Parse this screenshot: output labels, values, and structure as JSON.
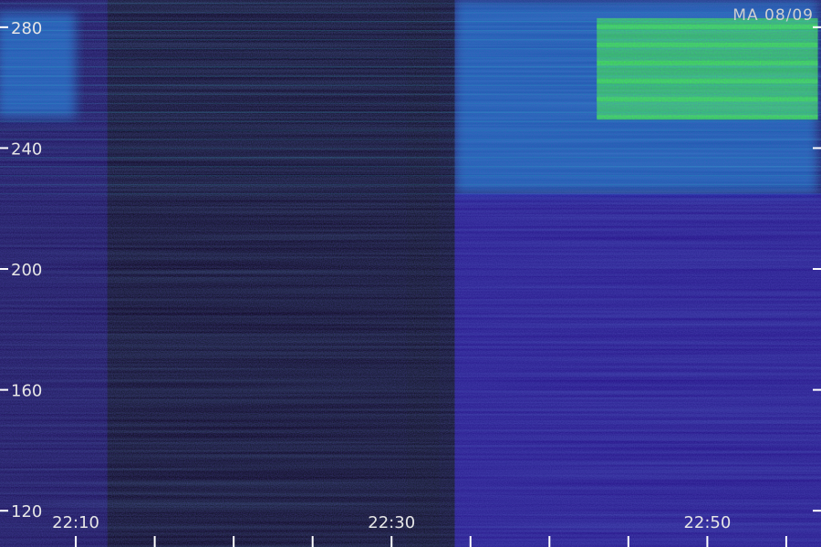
{
  "chart_data": {
    "type": "heatmap",
    "title": "",
    "corner_label": "MA 08/09",
    "xlabel": "",
    "ylabel": "",
    "x_unit": "time (HH:MM)",
    "x_range": [
      "22:05",
      "22:57"
    ],
    "x_tick_labels": [
      "22:10",
      "22:30",
      "22:50"
    ],
    "x_minor_ticks_minutes": [
      22.05,
      22.1,
      22.15,
      22.2,
      22.25,
      22.3,
      22.35,
      22.4,
      22.45,
      22.5,
      22.55
    ],
    "y_range": [
      108,
      289
    ],
    "y_tick_labels": [
      "120",
      "160",
      "200",
      "240",
      "280"
    ],
    "y_ticks": [
      120,
      160,
      200,
      240,
      280
    ],
    "grid": false,
    "colormap": [
      "#000000",
      "#1a0050",
      "#2a14c8",
      "#1f55ff",
      "#10a8ff",
      "#10e6c0",
      "#33ff33"
    ],
    "features": [
      {
        "kind": "quiet-gap",
        "t_start": "22:12",
        "t_end": "22:33",
        "level": "very low"
      },
      {
        "kind": "quiet-gap",
        "t_start": "22:31",
        "t_end": "22:34",
        "level": "very low"
      },
      {
        "kind": "intense-band",
        "t_start": "22:43",
        "t_end": "22:57",
        "y_from": 250,
        "y_to": 283,
        "level": "high"
      },
      {
        "kind": "elevated-band",
        "t_start": "22:34",
        "t_end": "22:57",
        "y_from": 225,
        "y_to": 289,
        "level": "medium"
      },
      {
        "kind": "elevated-band",
        "t_start": "22:05",
        "t_end": "22:10",
        "y_from": 250,
        "y_to": 285,
        "level": "medium"
      }
    ]
  }
}
